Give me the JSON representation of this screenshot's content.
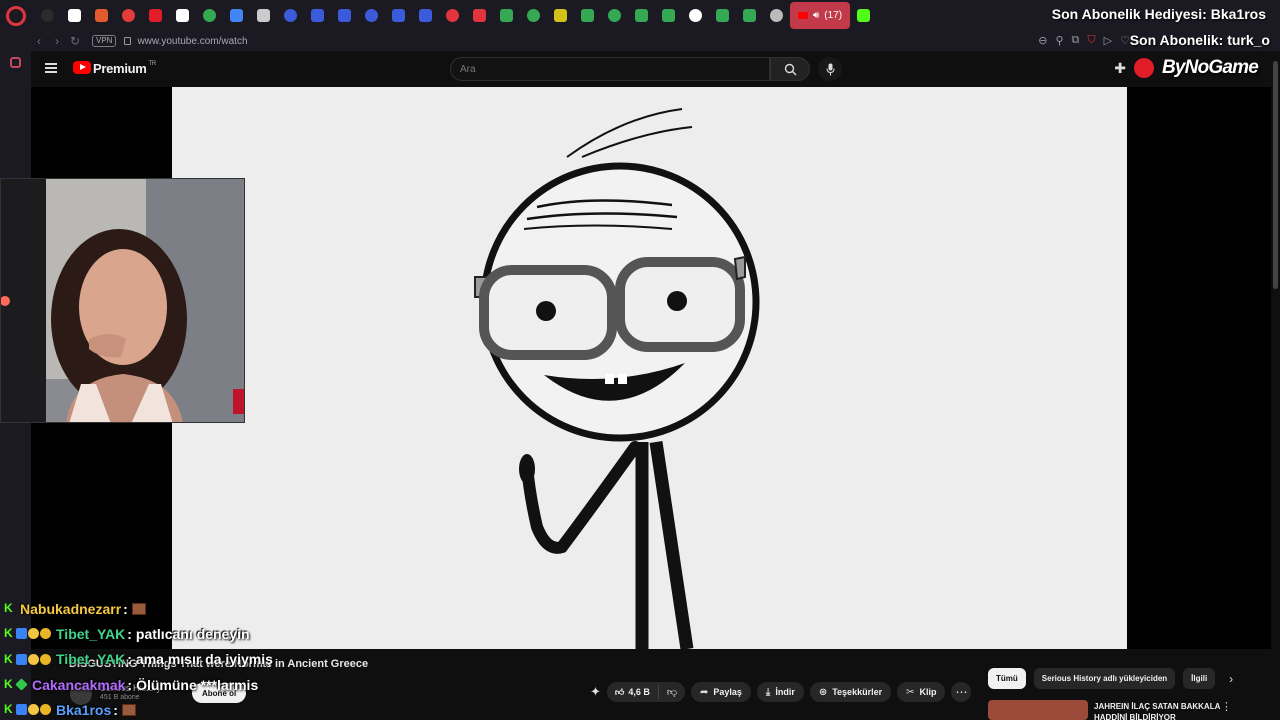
{
  "browser": {
    "url": "www.youtube.com/watch",
    "vpn_label": "VPN",
    "active_tab_count": "(17)",
    "tab_colors": [
      "#2b2b2b",
      "#ffffff",
      "#e25b2d",
      "#e23b3b",
      "#e11d2a",
      "#ffffff",
      "#34a853",
      "#4285f4",
      "#cccccc",
      "#3b5bdb",
      "#3b5bdb",
      "#3b5bdb",
      "#3b5bdb",
      "#3b5bdb",
      "#3b5bdb",
      "#e2343d",
      "#e2343d",
      "#34a853",
      "#34a853",
      "#d4c21a",
      "#34a853",
      "#34a853",
      "#34a853",
      "#34a853",
      "#ffffff",
      "#34a853",
      "#34a853",
      "#bbbbbb",
      "#53fc18"
    ]
  },
  "stream_overlay": {
    "last_gift": "Son Abonelik Hediyesi: Bka1ros",
    "last_sub": "Son Abonelik: turk_o",
    "sponsor": "ByNoGame"
  },
  "youtube": {
    "brand": "Premium",
    "region": "TR",
    "search_placeholder": "Ara"
  },
  "video": {
    "title": "DISGUSTING Things That were Normal in Ancient Greece",
    "channel": "Serious History",
    "subscribers": "451 B abone",
    "subscribe_label": "Abone ol",
    "likes": "4,6 B",
    "actions": {
      "share": "Paylaş",
      "download": "İndir",
      "thanks": "Teşekkürler",
      "clip": "Klip"
    }
  },
  "recommendations": {
    "chips": [
      "Tümü",
      "Serious History adlı yükleyiciden",
      "İlgili"
    ],
    "first_title": "JAHREIN İLAÇ SATAN BAKKALA HADDİNİ BİLDİRİYOR"
  },
  "chat": [
    {
      "user": "Nabukadnezarr",
      "color": "#f5c842",
      "badges": [
        "k"
      ],
      "message": "",
      "emote": true
    },
    {
      "user": "Tibet_YAK",
      "color": "#3fd48a",
      "badges": [
        "k",
        "b",
        "m",
        "y"
      ],
      "message": "patlıcanı deneyin",
      "emote": false
    },
    {
      "user": "Tibet_YAK",
      "color": "#3fd48a",
      "badges": [
        "k",
        "b",
        "m",
        "y"
      ],
      "message": "ama mısır da iyiymiş",
      "emote": false
    },
    {
      "user": "Cakancakmak",
      "color": "#b36bff",
      "badges": [
        "k",
        "g"
      ],
      "message": "Ölümüne ***larmis",
      "emote": false
    },
    {
      "user": "Bka1ros",
      "color": "#5aa0ff",
      "badges": [
        "k",
        "b",
        "m",
        "y"
      ],
      "message": "",
      "emote": true
    }
  ]
}
